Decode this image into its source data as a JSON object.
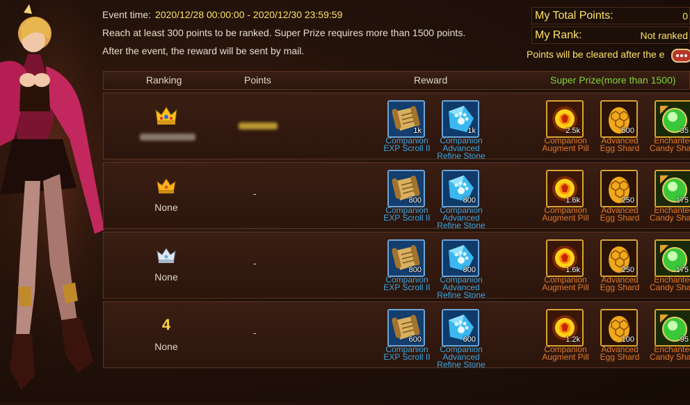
{
  "event": {
    "time_label": "Event time:",
    "time_value": "2020/12/28 00:00:00 - 2020/12/30 23:59:59",
    "rule_text": "Reach at least 300 points to be ranked. Super Prize requires more than 1500 points.",
    "mail_text": "After the event, the reward will be sent by mail."
  },
  "panel": {
    "total_points_label": "My Total Points:",
    "total_points_value": "0",
    "rank_label": "My Rank:",
    "rank_value": "Not ranked",
    "cleared_text": "Points will be cleared after the e"
  },
  "table": {
    "headers": {
      "ranking": "Ranking",
      "points": "Points",
      "reward": "Reward",
      "super_prize": "Super Prize(more than 1500)"
    },
    "rows": [
      {
        "rank_type": "gold-crown",
        "rank_number": "",
        "name": "",
        "points": "",
        "rewards": [
          {
            "name_line1": "Companion",
            "name_line2": "EXP Scroll II",
            "name_line3": "",
            "count": "1k",
            "icon": "scroll-icon"
          },
          {
            "name_line1": "Companion",
            "name_line2": "Advanced",
            "name_line3": "Refine Stone",
            "count": "1k",
            "icon": "paw-crystal-icon"
          }
        ],
        "super": [
          {
            "name_line1": "Companion",
            "name_line2": "Augment Pill",
            "count": "2.5k",
            "icon": "pill-icon"
          },
          {
            "name_line1": "Advanced",
            "name_line2": "Egg Shard",
            "count": "500",
            "icon": "egg-shard-icon"
          },
          {
            "name_line1": "Enchanted",
            "name_line2": "Candy Shard",
            "count": "35",
            "icon": "candy-icon"
          }
        ]
      },
      {
        "rank_type": "gold-crown-small",
        "rank_number": "",
        "name": "None",
        "points": "-",
        "rewards": [
          {
            "name_line1": "Companion",
            "name_line2": "EXP Scroll II",
            "name_line3": "",
            "count": "800",
            "icon": "scroll-icon"
          },
          {
            "name_line1": "Companion",
            "name_line2": "Advanced",
            "name_line3": "Refine Stone",
            "count": "800",
            "icon": "paw-crystal-icon"
          }
        ],
        "super": [
          {
            "name_line1": "Companion",
            "name_line2": "Augment Pill",
            "count": "1.6k",
            "icon": "pill-icon"
          },
          {
            "name_line1": "Advanced",
            "name_line2": "Egg Shard",
            "count": "250",
            "icon": "egg-shard-icon"
          },
          {
            "name_line1": "Enchanted",
            "name_line2": "Candy Shard",
            "count": "175",
            "icon": "candy-icon"
          }
        ]
      },
      {
        "rank_type": "silver-crown",
        "rank_number": "",
        "name": "None",
        "points": "-",
        "rewards": [
          {
            "name_line1": "Companion",
            "name_line2": "EXP Scroll II",
            "name_line3": "",
            "count": "800",
            "icon": "scroll-icon"
          },
          {
            "name_line1": "Companion",
            "name_line2": "Advanced",
            "name_line3": "Refine Stone",
            "count": "800",
            "icon": "paw-crystal-icon"
          }
        ],
        "super": [
          {
            "name_line1": "Companion",
            "name_line2": "Augment Pill",
            "count": "1.6k",
            "icon": "pill-icon"
          },
          {
            "name_line1": "Advanced",
            "name_line2": "Egg Shard",
            "count": "250",
            "icon": "egg-shard-icon"
          },
          {
            "name_line1": "Enchanted",
            "name_line2": "Candy Shard",
            "count": "175",
            "icon": "candy-icon"
          }
        ]
      },
      {
        "rank_type": "number",
        "rank_number": "4",
        "name": "None",
        "points": "-",
        "rewards": [
          {
            "name_line1": "Companion",
            "name_line2": "EXP Scroll II",
            "name_line3": "",
            "count": "600",
            "icon": "scroll-icon"
          },
          {
            "name_line1": "Companion",
            "name_line2": "Advanced",
            "name_line3": "Refine Stone",
            "count": "600",
            "icon": "paw-crystal-icon"
          }
        ],
        "super": [
          {
            "name_line1": "Companion",
            "name_line2": "Augment Pill",
            "count": "1.2k",
            "icon": "pill-icon"
          },
          {
            "name_line1": "Advanced",
            "name_line2": "Egg Shard",
            "count": "100",
            "icon": "egg-shard-icon"
          },
          {
            "name_line1": "Enchanted",
            "name_line2": "Candy Shard",
            "count": "95",
            "icon": "candy-icon"
          }
        ]
      }
    ]
  },
  "colors": {
    "accent_yellow": "#ffe36a",
    "reward_name_blue": "#3aa7e6",
    "super_name_orange": "#e37a2a",
    "super_header_green": "#7fd63a"
  }
}
